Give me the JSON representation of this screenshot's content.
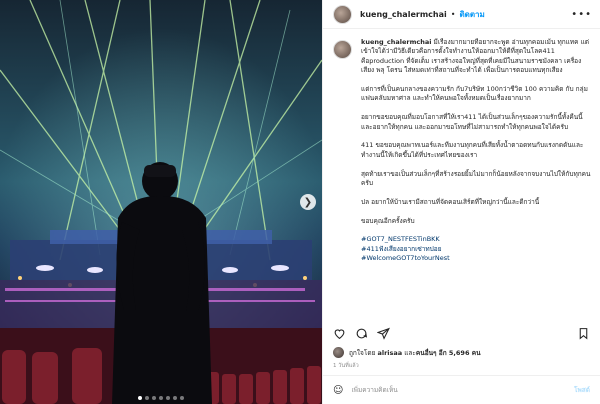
{
  "post": {
    "username": "kueng_chalermchai",
    "follow_label": "ติดตาม",
    "more_icon": "more-horizontal-icon",
    "caption": {
      "paragraphs": [
        "มีเรื่องมากมายที่อยากจะพูด อ่านทุกคอมเม้น ทุกแทค แต่เข้าใจได้ว่ามีวิธีเดียวคือการตั้งใจทำงานให้ออกมาให้ดีที่สุดในโลค411 คือproduction ที่จัดเต็ม เราสร้างจอใหญ่ที่สุดที่เคยมีในสนามราชมังคลา เครื่องเสียง พลุ โดรน ใส่หมดเท่าที่สถานที่จะทำได้ เพื่อเป็นการตอบแทนทุกเสียง",
        "แต่การที่เป็นคนกลางของความรัก กับ7บริษัท 100กว่าชีวิต 100 ความคิด กับ กลุ่มแฟนคลับมหาศาล และทำให้คนพอใจทั้งหมดเป็นเรื่องยากมาก",
        "อยากขอขอบคุณที่มอบโอกาสที่ให้เรา411 ได้เป็นส่วนเล็กๆของความรักนี้ทั้งคืนนี้และอยากให้ทุกคน และออกมาขอโทษที่ไม่สามารถทำให้ทุกคนพอใจได้ครับ",
        "411 ขอขอบคุณพาทเนอร์และทีมงานทุกคนที่เสียทั้งน้ำตาอดทนกับแรงกดดันและทำงานนี้ให้เกิดขึ้นได้ที่ประเทศไทยของเรา",
        "สุดท้ายเราขอเป็นส่วนเล็กๆที่สร้างรอยยิ้มไม่มากก็น้อยหลังจากจบงานไปให้กับทุกคนครับ",
        "ปล อยากให้บ้านเรามีสถานที่จัดคอนเสิร์ตที่ใหญ่กว่านี้และดีกว่านี้",
        "ขอบคุณอีกครั้งครับ"
      ],
      "hashtags": [
        "#GOT7_NESTFESTinBKK",
        "#411ฟังเสียงอยากเซ่าทปอย",
        "#WelcomeGOT7toYourNest"
      ]
    },
    "likes": {
      "prefix": "ถูกใจโดย",
      "liker": "alrisaa",
      "middle": "และ",
      "others": "คนอื่นๆ อีก 5,696 คน"
    },
    "time_ago": "1 วันที่แล้ว",
    "comment_placeholder": "เพิ่มความคิดเห็น",
    "post_button": "โพสต์",
    "carousel": {
      "total": 7,
      "active": 1
    },
    "icons": [
      "heart-icon",
      "comment-icon",
      "share-icon",
      "bookmark-icon",
      "emoji-icon",
      "chevron-right-icon"
    ]
  }
}
